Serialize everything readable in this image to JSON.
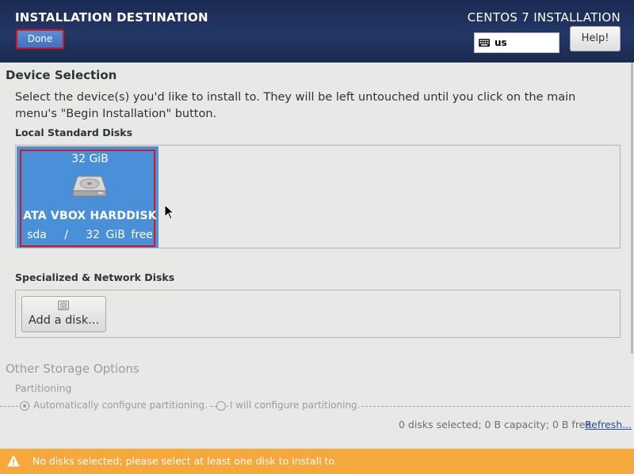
{
  "header": {
    "title": "INSTALLATION DESTINATION",
    "done_label": "Done",
    "product": "CENTOS 7 INSTALLATION",
    "keyboard_layout": "us",
    "help_label": "Help!"
  },
  "device_selection": {
    "heading": "Device Selection",
    "instructions": "Select the device(s) you'd like to install to.  They will be left untouched until you click on the main menu's \"Begin Installation\" button.",
    "local_heading": "Local Standard Disks",
    "disks": [
      {
        "size": "32 GiB",
        "name": "ATA VBOX HARDDISK",
        "path": "sda   /   32 GiB free",
        "selected": true
      }
    ],
    "specialized_heading": "Specialized & Network Disks",
    "add_disk_label": "Add a disk..."
  },
  "other_storage": {
    "heading": "Other Storage Options",
    "partitioning_heading": "Partitioning",
    "auto_option": "Automatically configure partitioning.",
    "manual_option": "I will configure partitioning."
  },
  "footer": {
    "summary": "0 disks selected; 0 B capacity; 0 B free",
    "refresh_label": "Refresh..."
  },
  "warning": {
    "text": "No disks selected; please select at least one disk to install to."
  },
  "colors": {
    "header_bg": "#1f305c",
    "selected_disk": "#4a90d9",
    "warning_bg": "#f5a83c",
    "highlight_border": "#d8141c"
  },
  "icons": [
    "keyboard-icon",
    "hard-disk-icon",
    "disk-small-icon",
    "warning-icon",
    "mouse-cursor-icon"
  ]
}
